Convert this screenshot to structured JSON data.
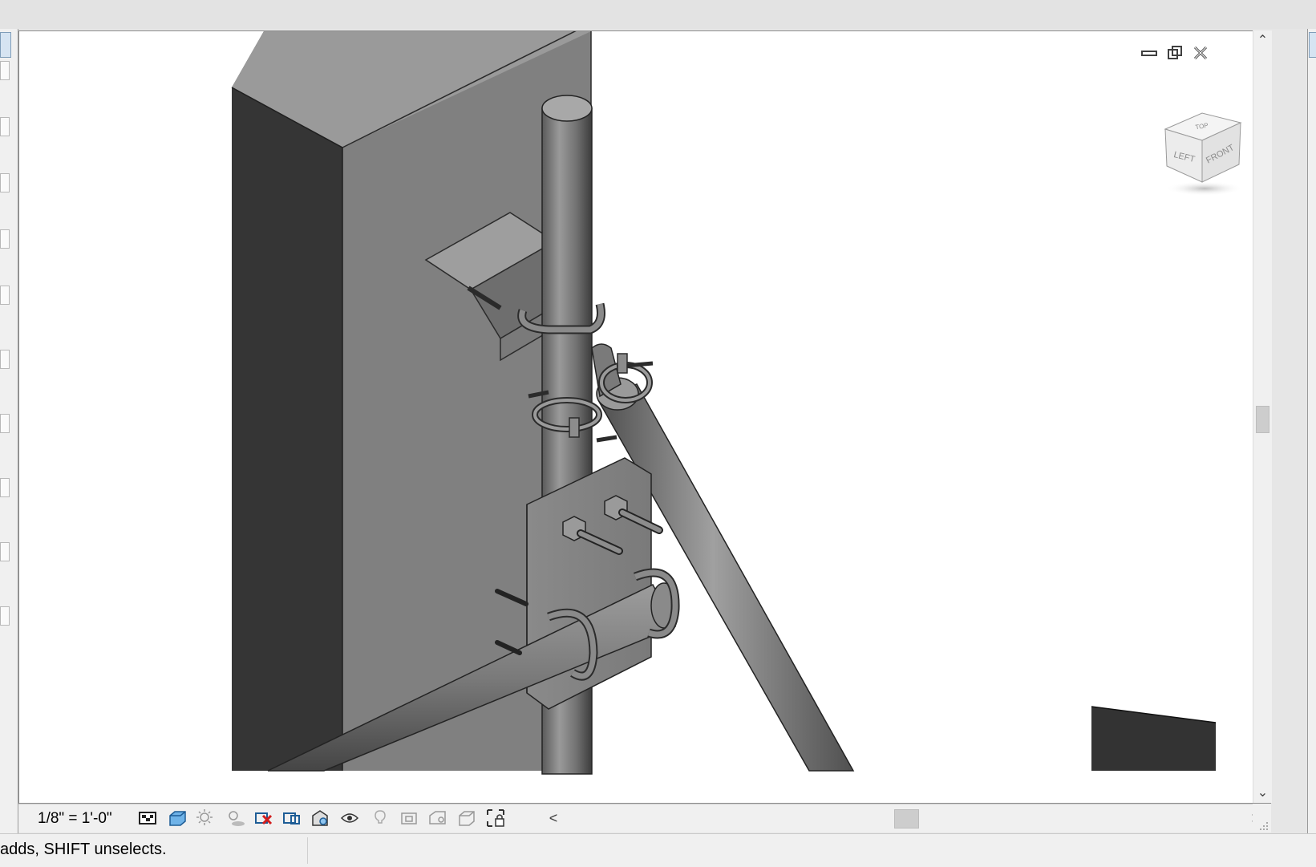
{
  "view": {
    "scale_label": "1/8\" = 1'-0\"",
    "controls": {
      "minimize": "minimize-icon",
      "restore": "restore-icon",
      "close": "close-icon"
    },
    "viewcube": {
      "top_face": "TOP",
      "left_face": "LEFT",
      "front_face": "FRONT"
    }
  },
  "view_control_bar": {
    "icons": [
      "scale-icon",
      "detail-level-icon",
      "visual-style-icon",
      "sun-path-icon",
      "shadows-icon",
      "crop-view-icon",
      "show-crop-region-icon",
      "temporary-hide-isolate-icon",
      "reveal-hidden-elements-icon",
      "worksharing-display-icon",
      "analytical-model-icon",
      "highlight-displacement-icon",
      "temporary-view-properties-icon",
      "lock-3d-view-icon",
      "constraints-icon"
    ]
  },
  "status": {
    "message": "adds, SHIFT unselects."
  },
  "colors": {
    "dark_face": "#373737",
    "mid_face": "#808080",
    "steel": "#6f6f6f",
    "highlight": "#cfcfcf"
  }
}
